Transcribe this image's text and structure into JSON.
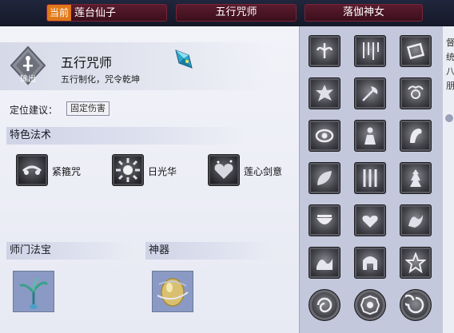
{
  "tabs": [
    {
      "prefix": "当前",
      "label": "莲台仙子"
    },
    {
      "label": "五行咒师"
    },
    {
      "label": "落伽神女"
    }
  ],
  "school": {
    "badge_label": "输出",
    "title": "五行咒师",
    "subtitle": "五行制化，咒令乾坤",
    "position_label": "定位建议：",
    "position_value": "固定伤害"
  },
  "spells": {
    "header": "特色法术",
    "items": [
      {
        "label": "紧箍咒",
        "icon": "headband-icon"
      },
      {
        "label": "日光华",
        "icon": "sunburst-icon"
      },
      {
        "label": "莲心剑意",
        "icon": "lotus-heart-icon"
      }
    ]
  },
  "treasure": {
    "header": "师门法宝",
    "icon": "jade-branch-icon"
  },
  "artifact": {
    "header": "神器",
    "icon": "golden-egg-icon"
  },
  "skill_grid": [
    "lotus-skill-icon",
    "ice-shards-skill-icon",
    "book-skill-icon",
    "explosion-skill-icon",
    "axe-skill-icon",
    "blossom-skill-icon",
    "eye-skill-icon",
    "figure-skill-icon",
    "crane-skill-icon",
    "leaf-skill-icon",
    "bamboo-skill-icon",
    "tower-skill-icon",
    "bowl-skill-icon",
    "hearts-skill-icon",
    "dragon-skill-icon",
    "wave-skill-icon",
    "helmet-skill-icon",
    "pentagram-skill-icon",
    "swirl-skill-icon",
    "bagua-skill-icon",
    "spiral-skill-icon"
  ],
  "edge_chars": [
    "督",
    "统",
    "八",
    "朋"
  ],
  "colors": {
    "accent_orange": "#e07818",
    "tab_red": "#5a1c2e",
    "grid_bg": "#c4c8dc"
  }
}
